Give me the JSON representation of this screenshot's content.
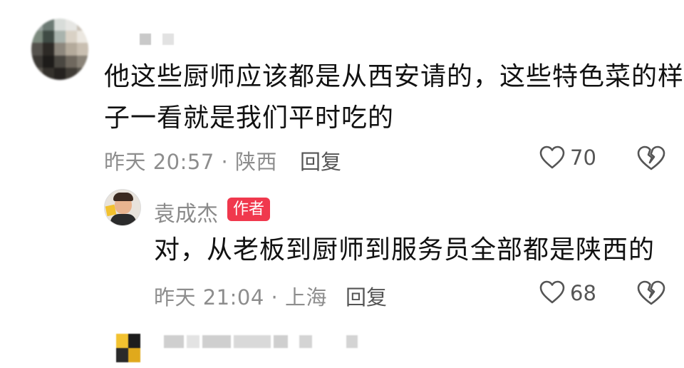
{
  "comments": [
    {
      "text_line1": "他这些厨师应该都是从西安请的，这些特色菜的样",
      "text_line2": "子一看就是我们平时吃的",
      "meta": "昨天 20:57 · 陕西",
      "reply_label": "回复",
      "likes": "70",
      "avatar_colors": [
        "#9aa39f",
        "#6c7a74",
        "#d8dcd9",
        "#e6e6e3",
        "#c9c1b6",
        "#7c8a7e",
        "#3f4a44",
        "#a9b3ad",
        "#d9d1c5",
        "#ebe7e0",
        "#55524d",
        "#2d2a26",
        "#8d877d",
        "#b4aa9b",
        "#c9bfb1",
        "#3b3834",
        "#1e1c1a",
        "#4a4741",
        "#6f685e",
        "#8a8378",
        "#5a564f",
        "#34312c",
        "#25221f",
        "#403c36",
        "#57534b"
      ]
    }
  ],
  "reply": {
    "author": "袁成杰",
    "badge": "作者",
    "text": "对，从老板到厨师到服务员全部都是陕西的",
    "meta": "昨天 21:04 · 上海",
    "reply_label": "回复",
    "likes": "68"
  }
}
